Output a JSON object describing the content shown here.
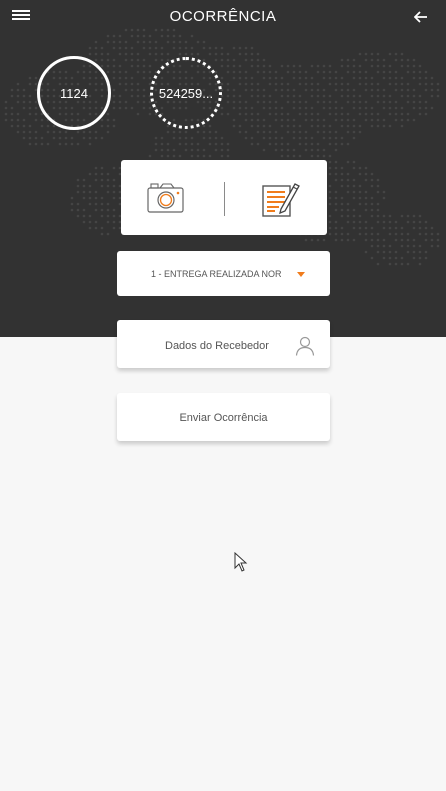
{
  "header": {
    "title": "OCORRÊNCIA",
    "menu_icon": "hamburger-menu-icon",
    "back_icon": "arrow-left-icon"
  },
  "stats": {
    "first_value": "1124",
    "second_value": "524259..."
  },
  "media": {
    "camera_icon": "camera-icon",
    "note_icon": "notepad-edit-icon",
    "accent_color": "#f07c1c"
  },
  "occurrence_select": {
    "value": "1 - ENTREGA REALIZADA NOR"
  },
  "receiver": {
    "label": "Dados do Recebedor",
    "icon": "user-icon"
  },
  "submit": {
    "label": "Enviar Ocorrência"
  },
  "colors": {
    "header_background": "#323232",
    "page_background": "#f7f7f7",
    "card_background": "#ffffff"
  }
}
